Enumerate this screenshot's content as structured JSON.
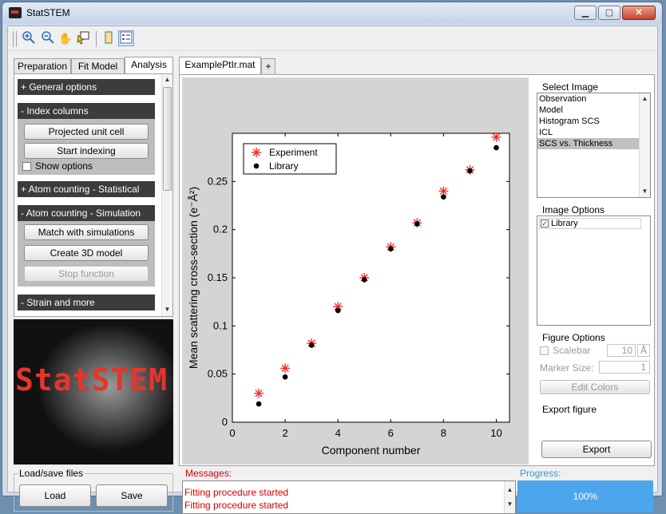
{
  "window": {
    "title": "StatSTEM"
  },
  "tabs": {
    "left": [
      "Preparation",
      "Fit Model",
      "Analysis"
    ],
    "file": "ExamplePtIr.mat",
    "add": "+"
  },
  "sections": {
    "general": "+ General options",
    "index": "- Index columns",
    "projected_unit_cell": "Projected unit cell",
    "start_indexing": "Start indexing",
    "show_options": "Show options",
    "atom_stat": "+ Atom counting - Statistical",
    "atom_sim": "- Atom counting - Simulation",
    "match": "Match with simulations",
    "create3d": "Create 3D model",
    "stop": "Stop function",
    "strain": "- Strain and more"
  },
  "logo": {
    "text": "StatSTEM"
  },
  "loadsave": {
    "title": "Load/save files",
    "load": "Load",
    "save": "Save"
  },
  "select_image": {
    "title": "Select Image",
    "items": [
      "Observation",
      "Model",
      "Histogram SCS",
      "ICL",
      "SCS vs. Thickness"
    ],
    "selected_index": 4
  },
  "image_options": {
    "title": "Image Options",
    "library_label": "Library",
    "library_checked": true
  },
  "figure_options": {
    "title": "Figure Options",
    "scalebar_label": "Scalebar",
    "scalebar_value": "10",
    "scalebar_unit": "Å",
    "marker_label": "Marker Size:",
    "marker_value": "1",
    "edit_colors": "Edit Colors"
  },
  "export": {
    "title": "Export figure",
    "button": "Export"
  },
  "messages": {
    "title": "Messages:",
    "lines": [
      "Fitting procedure started",
      "Fitting procedure started"
    ]
  },
  "progress": {
    "title": "Progress:",
    "value_text": "100%",
    "fraction": 1.0
  },
  "colors": {
    "experiment": "#ff2020",
    "library": "#000000",
    "section_bar": "#3c3c3c",
    "progress": "#4da6ec"
  },
  "chart_data": {
    "type": "scatter",
    "xlabel": "Component number",
    "ylabel": "Mean scattering cross-section (e⁻Å²)",
    "xlim": [
      0,
      10.5
    ],
    "ylim": [
      0,
      0.3
    ],
    "xticks": [
      0,
      2,
      4,
      6,
      8,
      10
    ],
    "yticks": [
      0,
      0.05,
      0.1,
      0.15,
      0.2,
      0.25
    ],
    "ytick_labels": [
      "0",
      "0.05",
      "0.1",
      "0.15",
      "0.2",
      "0.25"
    ],
    "legend_position": "top-left",
    "series": [
      {
        "name": "Experiment",
        "marker": "asterisk",
        "x": [
          1,
          2,
          3,
          4,
          5,
          6,
          7,
          8,
          9,
          10
        ],
        "y": [
          0.03,
          0.056,
          0.082,
          0.12,
          0.15,
          0.182,
          0.207,
          0.24,
          0.262,
          0.296
        ]
      },
      {
        "name": "Library",
        "marker": "dot",
        "x": [
          1,
          2,
          3,
          4,
          5,
          6,
          7,
          8,
          9,
          10
        ],
        "y": [
          0.019,
          0.047,
          0.08,
          0.116,
          0.148,
          0.18,
          0.206,
          0.234,
          0.261,
          0.285
        ]
      }
    ]
  }
}
